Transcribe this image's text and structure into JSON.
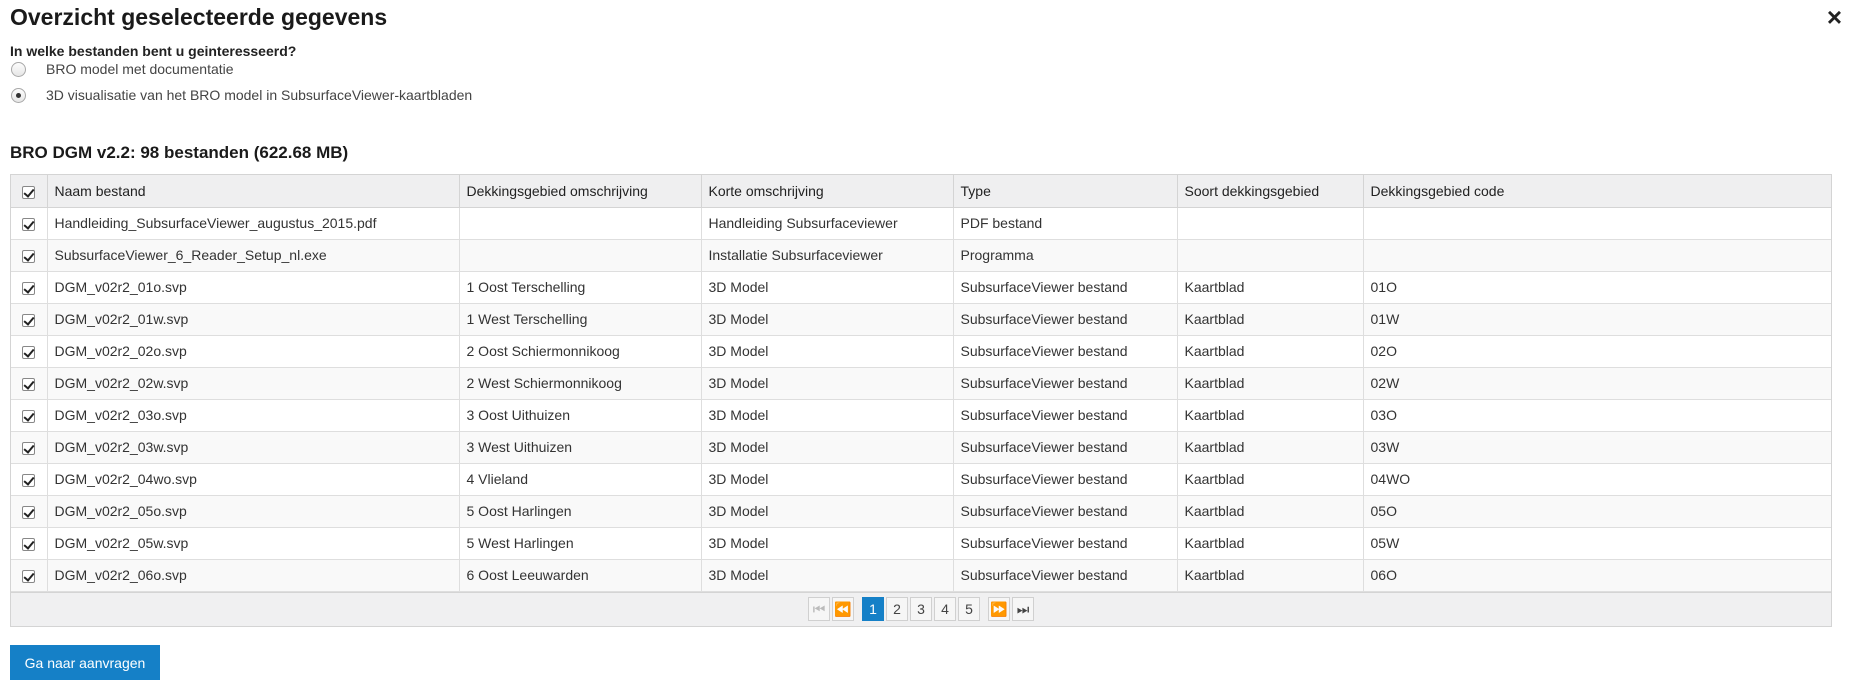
{
  "dialog": {
    "title": "Overzicht geselecteerde gegevens",
    "close_icon": "×"
  },
  "question": {
    "label": "In welke bestanden bent u geinteresseerd?",
    "options": [
      {
        "label": "BRO model met documentatie",
        "selected": false
      },
      {
        "label": "3D visualisatie van het BRO model in SubsurfaceViewer-kaartbladen",
        "selected": true
      }
    ]
  },
  "section": {
    "title": "BRO DGM v2.2: 98 bestanden (622.68 MB)"
  },
  "table": {
    "columns": [
      "Naam bestand",
      "Dekkingsgebied omschrijving",
      "Korte omschrijving",
      "Type",
      "Soort dekkingsgebied",
      "Dekkingsgebied code"
    ],
    "rows": [
      [
        "Handleiding_SubsurfaceViewer_augustus_2015.pdf",
        "",
        "Handleiding Subsurfaceviewer",
        "PDF bestand",
        "",
        ""
      ],
      [
        "SubsurfaceViewer_6_Reader_Setup_nl.exe",
        "",
        "Installatie Subsurfaceviewer",
        "Programma",
        "",
        ""
      ],
      [
        "DGM_v02r2_01o.svp",
        "1 Oost Terschelling",
        "3D Model",
        "SubsurfaceViewer bestand",
        "Kaartblad",
        "01O"
      ],
      [
        "DGM_v02r2_01w.svp",
        "1 West Terschelling",
        "3D Model",
        "SubsurfaceViewer bestand",
        "Kaartblad",
        "01W"
      ],
      [
        "DGM_v02r2_02o.svp",
        "2 Oost Schiermonnikoog",
        "3D Model",
        "SubsurfaceViewer bestand",
        "Kaartblad",
        "02O"
      ],
      [
        "DGM_v02r2_02w.svp",
        "2 West Schiermonnikoog",
        "3D Model",
        "SubsurfaceViewer bestand",
        "Kaartblad",
        "02W"
      ],
      [
        "DGM_v02r2_03o.svp",
        "3 Oost Uithuizen",
        "3D Model",
        "SubsurfaceViewer bestand",
        "Kaartblad",
        "03O"
      ],
      [
        "DGM_v02r2_03w.svp",
        "3 West Uithuizen",
        "3D Model",
        "SubsurfaceViewer bestand",
        "Kaartblad",
        "03W"
      ],
      [
        "DGM_v02r2_04wo.svp",
        "4 Vlieland",
        "3D Model",
        "SubsurfaceViewer bestand",
        "Kaartblad",
        "04WO"
      ],
      [
        "DGM_v02r2_05o.svp",
        "5 Oost Harlingen",
        "3D Model",
        "SubsurfaceViewer bestand",
        "Kaartblad",
        "05O"
      ],
      [
        "DGM_v02r2_05w.svp",
        "5 West Harlingen",
        "3D Model",
        "SubsurfaceViewer bestand",
        "Kaartblad",
        "05W"
      ],
      [
        "DGM_v02r2_06o.svp",
        "6 Oost Leeuwarden",
        "3D Model",
        "SubsurfaceViewer bestand",
        "Kaartblad",
        "06O"
      ]
    ]
  },
  "pager": {
    "first_icon": "⏮",
    "prev_icon": "⏪",
    "pages": [
      "1",
      "2",
      "3",
      "4",
      "5"
    ],
    "current_page": "1",
    "next_icon": "⏩",
    "last_icon": "⏭"
  },
  "actions": {
    "submit_label": "Ga naar aanvragen",
    "accent_color": "#1580c7"
  }
}
